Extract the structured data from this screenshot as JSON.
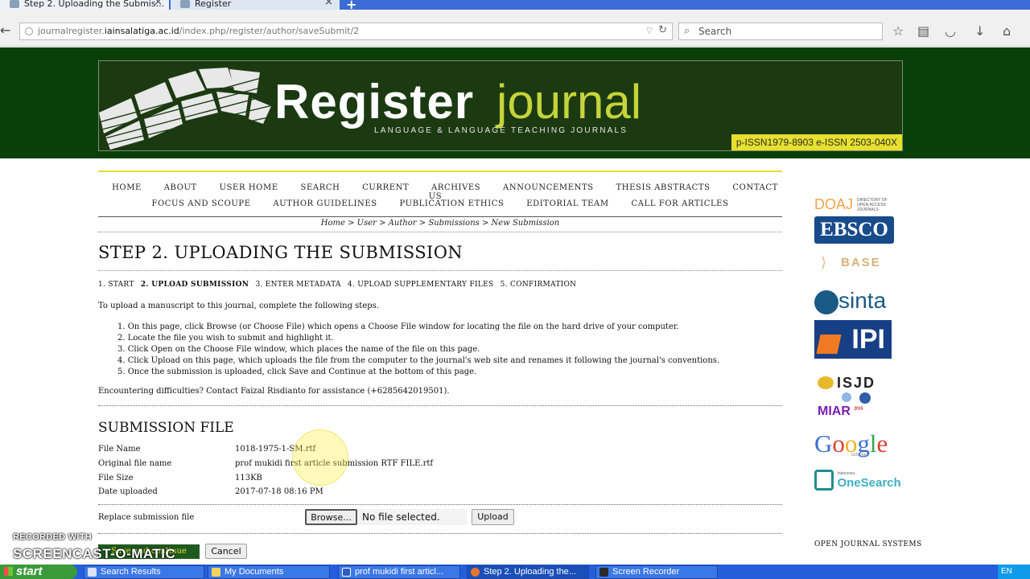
{
  "browser": {
    "tabs": [
      {
        "label": "Step 2. Uploading the Submis...",
        "active": true
      },
      {
        "label": "Register",
        "active": false
      }
    ],
    "url_host": "journalregister.iainsalatiga.ac.id",
    "url_path": "/index.php/register/author/saveSubmit/2",
    "url_prefix": "journalregister.",
    "url_host_bold": "iainsalatiga.ac.id",
    "search_placeholder": "Search"
  },
  "header": {
    "title_word1": "Register",
    "title_word2": "journal",
    "subtitle": "LANGUAGE & LANGUAGE TEACHING JOURNALS",
    "issn": "p-ISSN1979-8903 e-ISSN 2503-040X"
  },
  "menu": {
    "row1": [
      "HOME",
      "ABOUT",
      "USER HOME",
      "SEARCH",
      "CURRENT",
      "ARCHIVES",
      "ANNOUNCEMENTS",
      "THESIS ABSTRACTS",
      "CONTACT US"
    ],
    "row2": [
      "FOCUS AND SCOUPE",
      "AUTHOR GUIDELINES",
      "PUBLICATION ETHICS",
      "EDITORIAL TEAM",
      "CALL FOR ARTICLES"
    ]
  },
  "breadcrumb": [
    "Home",
    "User",
    "Author",
    "Submissions",
    "New Submission"
  ],
  "breadcrumb_sep": " > ",
  "page_title": "STEP 2. UPLOADING THE SUBMISSION",
  "steps": [
    {
      "label": "1. START",
      "current": false
    },
    {
      "label": "2. UPLOAD SUBMISSION",
      "current": true
    },
    {
      "label": "3. ENTER METADATA",
      "current": false
    },
    {
      "label": "4. UPLOAD SUPPLEMENTARY FILES",
      "current": false
    },
    {
      "label": "5. CONFIRMATION",
      "current": false
    }
  ],
  "intro": "To upload a manuscript to this journal, complete the following steps.",
  "instructions": [
    "1. On this page, click Browse (or Choose File) which opens a Choose File window for locating the file on the hard drive of your computer.",
    "2. Locate the file you wish to submit and highlight it.",
    "3. Click Open on the Choose File window, which places the name of the file on this page.",
    "4. Click Upload on this page, which uploads the file from the computer to the journal's web site and renames it following the journal's conventions.",
    "5. Once the submission is uploaded, click Save and Continue at the bottom of this page."
  ],
  "help_text": "Encountering difficulties? Contact Faizal Risdianto for assistance (+6285642019501).",
  "submission_file": {
    "heading": "SUBMISSION FILE",
    "rows": [
      {
        "label": "File Name",
        "value": "1018-1975-1-SM.rtf"
      },
      {
        "label": "Original file name",
        "value": "prof mukidi first article submission RTF FILE.rtf"
      },
      {
        "label": "File Size",
        "value": "113KB"
      },
      {
        "label": "Date uploaded",
        "value": "2017-07-18 08:16 PM"
      }
    ],
    "replace_label": "Replace submission file",
    "browse_label": "Browse...",
    "no_file": "No file selected.",
    "upload_label": "Upload"
  },
  "actions": {
    "save_label": "Save and continue",
    "cancel_label": "Cancel"
  },
  "sidebar": {
    "doaj": "DOAJ",
    "doaj_small": "DIRECTORY OF OPEN ACCESS JOURNALS",
    "ebsco": "EBSCO",
    "base": "BASE",
    "sinta": "sinta",
    "ipi": "IPI",
    "isjd": "ISJD",
    "miar": "MIAR",
    "miar_year": "2015",
    "google": "Google",
    "google_sub": "scholar",
    "onesearch": "OneSearch",
    "onesearch_prefix": "Indonesia",
    "ojs": "OPEN JOURNAL SYSTEMS"
  },
  "watermark": {
    "line1": "RECORDED WITH",
    "line2": "SCREENCAST-O-MATIC"
  },
  "taskbar": {
    "start": "start",
    "items": [
      "Search Results",
      "My Documents",
      "prof mukidi first articl...",
      "Step 2. Uploading the...",
      "Screen Recorder"
    ],
    "lang": "EN"
  }
}
